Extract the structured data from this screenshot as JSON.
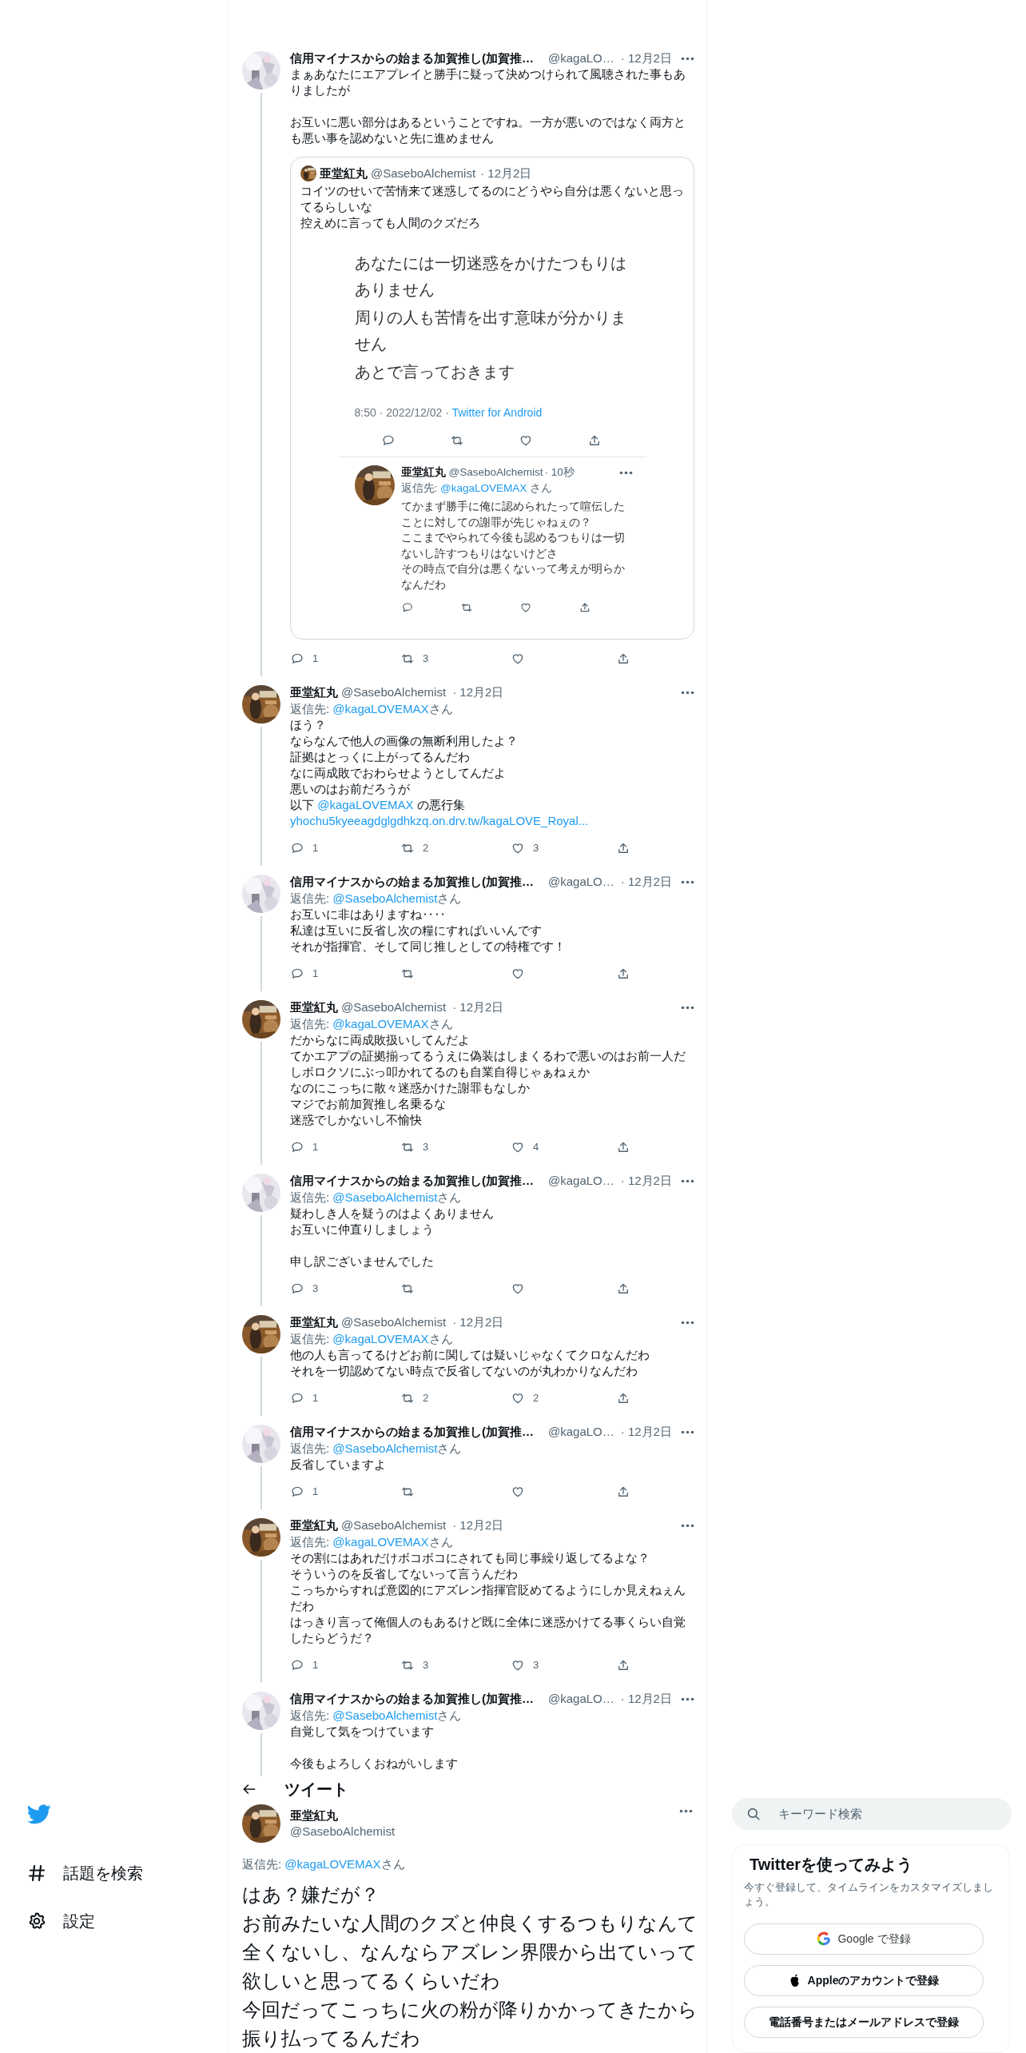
{
  "thread": [
    {
      "name": "信用マイナスからの始まる加賀推し(加賀推…",
      "handle": "@kagaLO…",
      "date": "· 12月2日",
      "text": [
        [
          "まぁあなたにエアプレイと勝手に疑って決めつけられて風聴された事もありましたが"
        ],
        [
          "お互いに悪い部分はあるということですね。一方が悪いのではなく両方とも悪い事を認めないと先に進めません"
        ]
      ],
      "quote": {
        "name": "亜堂紅丸",
        "handle": "@SaseboAlchemist",
        "date": "· 12月2日",
        "text": [
          [
            "コイツのせいで苦情来て迷惑してるのにどうやら自分は悪くないと思ってるらしいな",
            "控えめに言っても人間のクズだろ"
          ]
        ],
        "image": {
          "paragraphs": [
            "あなたには一切迷惑をかけたつもりはありません",
            "周りの人も苦情を出す意味が分かりません",
            "あとで言っておきます"
          ],
          "meta": "8:50 · 2022/12/02 · ",
          "source": "Twitter for Android",
          "reply": {
            "name": "亜堂紅丸",
            "handle": "@SaseboAlchemist",
            "date": "· 10秒",
            "reply_label": "返信先: ",
            "reply_handle": "@kagaLOVEMAX",
            "reply_suffix": " さん",
            "text": [
              [
                "てかまず勝手に俺に認められたって喧伝したことに対しての謝罪が先じゃねぇの？",
                "ここまでやられて今後も認めるつもりは一切ないし許すつもりはないけどさ",
                "その時点で自分は悪くないって考えが明らかなんだわ"
              ]
            ]
          }
        }
      },
      "actions": [
        {
          "kind": "reply",
          "count": "1"
        },
        {
          "kind": "retweet",
          "count": "3"
        },
        {
          "kind": "like"
        },
        {
          "kind": "share"
        }
      ]
    },
    {
      "name": "亜堂紅丸",
      "handle": "@SaseboAlchemist",
      "date": "· 12月2日",
      "reply_label": "返信先: ",
      "reply_handle": "@kagaLOVEMAX",
      "reply_suffix": "さん",
      "text": [
        [
          "ほう？",
          "ならなんで他人の画像の無断利用したよ？",
          "証拠はとっくに上がってるんだわ",
          "なに両成敗でおわらせようとしてんだよ",
          "悪いのはお前だろうが",
          [
            {
              "kind": "text",
              "text": "以下 "
            },
            {
              "kind": "link",
              "text": "@kagaLOVEMAX"
            },
            {
              "kind": "text",
              "text": " の悪行集"
            }
          ],
          [
            {
              "kind": "link",
              "text": "yhochu5kyeeagdglgdhkzq.on.drv.tw/kagaLOVE_Royal..."
            }
          ]
        ]
      ],
      "actions": [
        {
          "kind": "reply",
          "count": "1"
        },
        {
          "kind": "retweet",
          "count": "2"
        },
        {
          "kind": "like",
          "count": "3"
        },
        {
          "kind": "share"
        }
      ]
    },
    {
      "name": "信用マイナスからの始まる加賀推し(加賀推…",
      "handle": "@kagaLO…",
      "date": "· 12月2日",
      "reply_label": "返信先: ",
      "reply_handle": "@SaseboAlchemist",
      "reply_suffix": "さん",
      "text": [
        [
          "お互いに非はありますね‥‥",
          "私達は互いに反省し次の糧にすればいいんです",
          "それが指揮官、そして同じ推しとしての特権です！"
        ]
      ],
      "actions": [
        {
          "kind": "reply",
          "count": "1"
        },
        {
          "kind": "retweet"
        },
        {
          "kind": "like"
        },
        {
          "kind": "share"
        }
      ]
    },
    {
      "name": "亜堂紅丸",
      "handle": "@SaseboAlchemist",
      "date": "· 12月2日",
      "reply_label": "返信先: ",
      "reply_handle": "@kagaLOVEMAX",
      "reply_suffix": "さん",
      "text": [
        [
          "だからなに両成敗扱いしてんだよ",
          "てかエアプの証拠揃ってるうえに偽装はしまくるわで悪いのはお前一人だしボロクソにぶっ叩かれてるのも自業自得じゃぁねぇか",
          "なのにこっちに散々迷惑かけた謝罪もなしか",
          "マジでお前加賀推し名乗るな",
          "迷惑でしかないし不愉快"
        ]
      ],
      "actions": [
        {
          "kind": "reply",
          "count": "1"
        },
        {
          "kind": "retweet",
          "count": "3"
        },
        {
          "kind": "like",
          "count": "4"
        },
        {
          "kind": "share"
        }
      ]
    },
    {
      "name": "信用マイナスからの始まる加賀推し(加賀推…",
      "handle": "@kagaLO…",
      "date": "· 12月2日",
      "reply_label": "返信先: ",
      "reply_handle": "@SaseboAlchemist",
      "reply_suffix": "さん",
      "text": [
        [
          "疑わしき人を疑うのはよくありません",
          "お互いに仲直りしましょう"
        ],
        [
          "申し訳ございませんでした"
        ]
      ],
      "actions": [
        {
          "kind": "reply",
          "count": "3"
        },
        {
          "kind": "retweet"
        },
        {
          "kind": "like"
        },
        {
          "kind": "share"
        }
      ]
    },
    {
      "name": "亜堂紅丸",
      "handle": "@SaseboAlchemist",
      "date": "· 12月2日",
      "reply_label": "返信先: ",
      "reply_handle": "@kagaLOVEMAX",
      "reply_suffix": "さん",
      "text": [
        [
          "他の人も言ってるけどお前に関しては疑いじゃなくてクロなんだわ",
          "それを一切認めてない時点で反省してないのが丸わかりなんだわ"
        ]
      ],
      "actions": [
        {
          "kind": "reply",
          "count": "1"
        },
        {
          "kind": "retweet",
          "count": "2"
        },
        {
          "kind": "like",
          "count": "2"
        },
        {
          "kind": "share"
        }
      ]
    },
    {
      "name": "信用マイナスからの始まる加賀推し(加賀推…",
      "handle": "@kagaLO…",
      "date": "· 12月2日",
      "reply_label": "返信先: ",
      "reply_handle": "@SaseboAlchemist",
      "reply_suffix": "さん",
      "text": [
        [
          "反省していますよ"
        ]
      ],
      "actions": [
        {
          "kind": "reply",
          "count": "1"
        },
        {
          "kind": "retweet"
        },
        {
          "kind": "like"
        },
        {
          "kind": "share"
        }
      ]
    },
    {
      "name": "亜堂紅丸",
      "handle": "@SaseboAlchemist",
      "date": "· 12月2日",
      "reply_label": "返信先: ",
      "reply_handle": "@kagaLOVEMAX",
      "reply_suffix": "さん",
      "text": [
        [
          "その割にはあれだけボコボコにされても同じ事繰り返してるよな？",
          "そういうのを反省してないって言うんだわ",
          "こっちからすれば意図的にアズレン指揮官貶めてるようにしか見えねぇんだわ",
          "はっきり言って俺個人のもあるけど既に全体に迷惑かけてる事くらい自覚したらどうだ？"
        ]
      ],
      "actions": [
        {
          "kind": "reply",
          "count": "1"
        },
        {
          "kind": "retweet",
          "count": "3"
        },
        {
          "kind": "like",
          "count": "3"
        },
        {
          "kind": "share"
        }
      ]
    },
    {
      "name": "信用マイナスからの始まる加賀推し(加賀推…",
      "handle": "@kagaLO…",
      "date": "· 12月2日",
      "reply_label": "返信先: ",
      "reply_handle": "@SaseboAlchemist",
      "reply_suffix": "さん",
      "text": [
        [
          "自覚して気をつけています"
        ],
        [
          "今後もよろしくおねがいします"
        ]
      ]
    }
  ],
  "sidebar": {
    "items": [
      {
        "kind": "hash",
        "label": "話題を検索"
      },
      {
        "kind": "gear",
        "label": "設定"
      }
    ]
  },
  "header": {
    "title": "ツイート"
  },
  "main_tweet": {
    "name": "亜堂紅丸",
    "handle": "@SaseboAlchemist",
    "reply_label": "返信先: ",
    "reply_handle": "@kagaLOVEMAX",
    "reply_suffix": "さん",
    "text": [
      [
        "はあ？嫌だが？",
        "お前みたいな人間のクズと仲良くするつもりなんて全くないし、なんならアズレン界隈から出ていって欲しいと思ってるくらいだわ",
        "今回だってこっちに火の粉が降りかかってきたから振り払ってるんだわ"
      ]
    ]
  },
  "search": {
    "placeholder": "キーワード検索"
  },
  "signup_card": {
    "title": "Twitterを使ってみよう",
    "text": "今すぐ登録して、タイムラインをカスタマイズしましょう。",
    "buttons": [
      {
        "kind": "google",
        "label": "Google で登録"
      },
      {
        "kind": "apple",
        "label": "Appleのアカウントで登録"
      },
      {
        "kind": "plain",
        "label": "電話番号またはメールアドレスで登録"
      }
    ]
  }
}
